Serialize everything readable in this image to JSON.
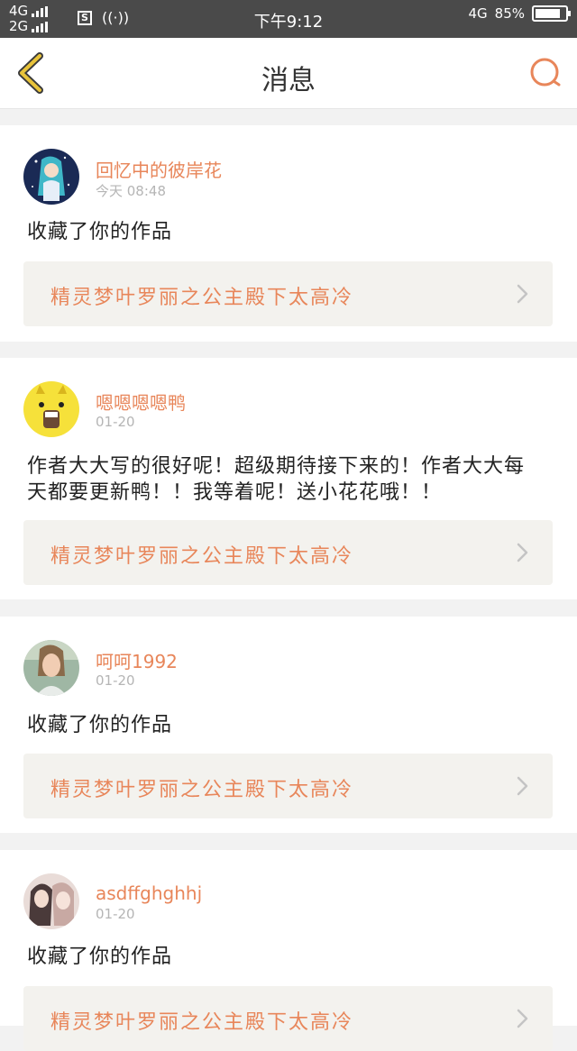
{
  "status_bar": {
    "net1": "4G",
    "net2": "2G",
    "sim_icon": "S",
    "radio_icon": "((·))",
    "time": "下午9:12",
    "net_right": "4G",
    "battery": "85%",
    "battery_level": 0.85
  },
  "nav": {
    "title": "消息",
    "back_icon": "chevron-left-icon",
    "search_icon": "search-icon",
    "accent": "#e8865a"
  },
  "messages": [
    {
      "username": "回忆中的彼岸花",
      "time": "今天 08:48",
      "text": "收藏了你的作品",
      "work_title": "精灵梦叶罗丽之公主殿下太高冷"
    },
    {
      "username": "嗯嗯嗯嗯鸭",
      "time": "01-20",
      "text": "作者大大写的很好呢！超级期待接下来的！作者大大每天都要更新鸭！！我等着呢！送小花花哦！！",
      "work_title": "精灵梦叶罗丽之公主殿下太高冷"
    },
    {
      "username": "呵呵1992",
      "time": "01-20",
      "text": "收藏了你的作品",
      "work_title": "精灵梦叶罗丽之公主殿下太高冷"
    },
    {
      "username": "asdffghghhj",
      "time": "01-20",
      "text": "收藏了你的作品",
      "work_title": "精灵梦叶罗丽之公主殿下太高冷"
    }
  ]
}
